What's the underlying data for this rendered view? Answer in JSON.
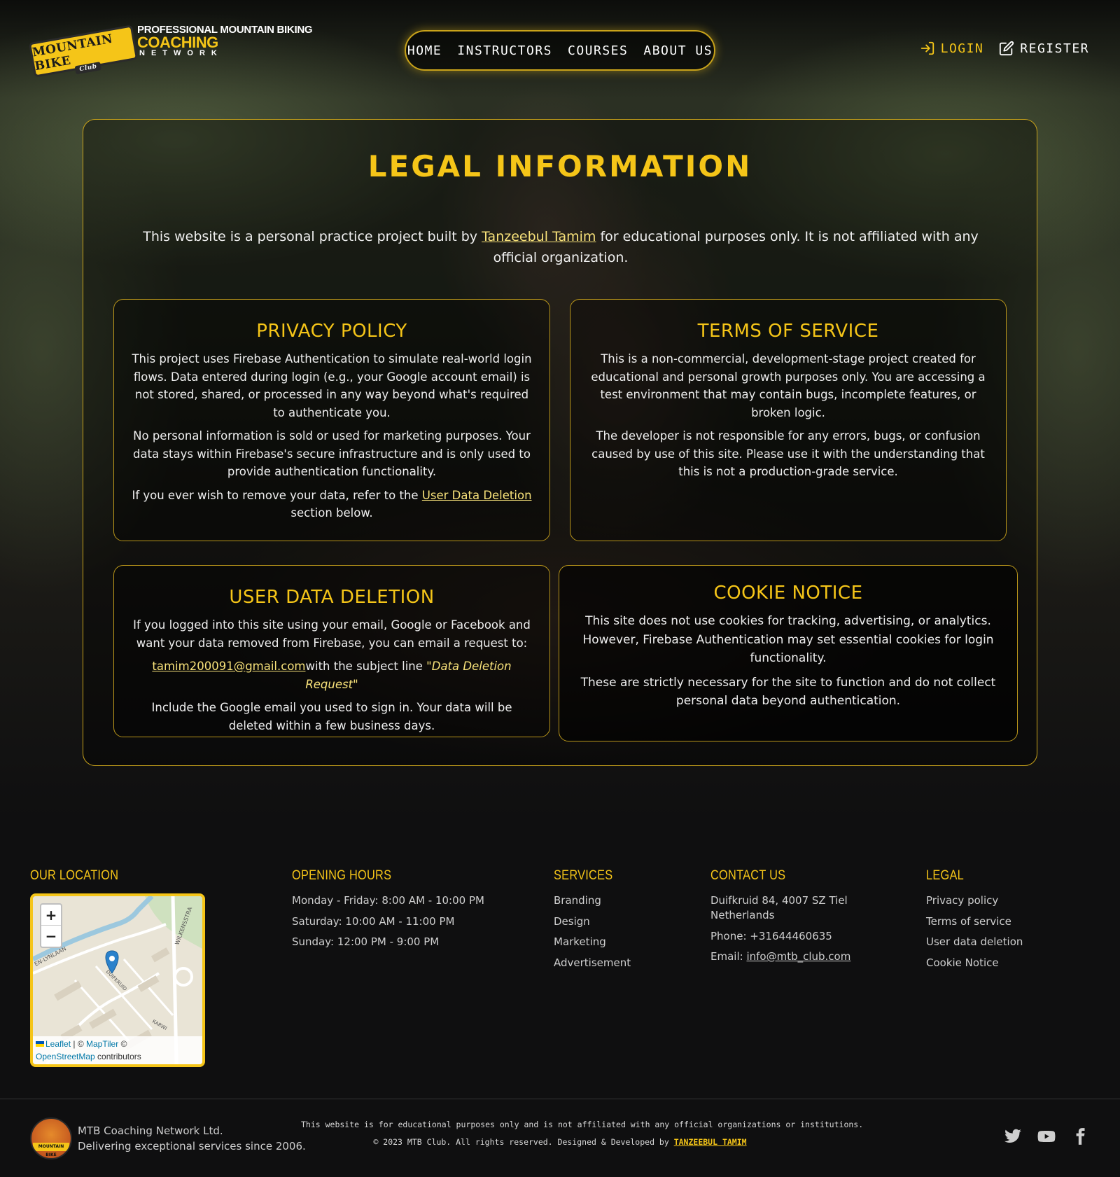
{
  "header": {
    "logo": {
      "badge_text": "MOUNTAIN BIKE",
      "badge_sub": "Club",
      "line1": "PROFESSIONAL MOUNTAIN BIKING",
      "line2": "COACHING",
      "line3": "NETWORK"
    },
    "nav": [
      "HOME",
      "INSTRUCTORS",
      "COURSES",
      "ABOUT US"
    ],
    "login_label": "LOGIN",
    "register_label": "REGISTER"
  },
  "legal": {
    "title": "LEGAL INFORMATION",
    "intro_before": "This website is a personal practice project built by ",
    "intro_link": "Tanzeebul Tamim",
    "intro_after": " for educational purposes only. It is not affiliated with any official organization.",
    "privacy": {
      "title": "PRIVACY POLICY",
      "p1": "This project uses Firebase Authentication to simulate real-world login flows. Data entered during login (e.g., your Google account email) is not stored, shared, or processed in any way beyond what's required to authenticate you.",
      "p2": "No personal information is sold or used for marketing purposes. Your data stays within Firebase's secure infrastructure and is only used to provide authentication functionality.",
      "p3_before": "If you ever wish to remove your data, refer to the ",
      "p3_link": "User Data Deletion",
      "p3_after": " section below."
    },
    "terms": {
      "title": "TERMS OF SERVICE",
      "p1": "This is a non-commercial, development-stage project created for educational and personal growth purposes only. You are accessing a test environment that may contain bugs, incomplete features, or broken logic.",
      "p2": "The developer is not responsible for any errors, bugs, or confusion caused by use of this site. Please use it with the understanding that this is not a production-grade service."
    },
    "deletion": {
      "title": "USER DATA DELETION",
      "p1": "If you logged into this site using your email, Google or Facebook and want your data removed from Firebase, you can email a request to:",
      "email": "tamim200091@gmail.com",
      "subject_before": "with the subject line ",
      "subject": "\"Data Deletion Request\"",
      "p3": "Include the Google email you used to sign in. Your data will be deleted within a few business days."
    },
    "cookie": {
      "title": "COOKIE NOTICE",
      "p1": "This site does not use cookies for tracking, advertising, or analytics. However, Firebase Authentication may set essential cookies for login functionality.",
      "p2": "These are strictly necessary for the site to function and do not collect personal data beyond authentication."
    }
  },
  "footer": {
    "location": {
      "title": "OUR LOCATION",
      "zoom_in": "+",
      "zoom_out": "−",
      "attrib_leaflet": "Leaflet",
      "attrib_sep": " | © ",
      "attrib_maptiler": "MapTiler",
      "attrib_copy": " ©",
      "attrib_osm": "OpenStreetMap",
      "attrib_contrib": " contributors",
      "street1": "WILKENSSTRA",
      "street2": "EN-LYNLAAN",
      "street3": "DUIFKRUID",
      "street4": "KARWI"
    },
    "hours": {
      "title": "OPENING HOURS",
      "lines": [
        "Monday - Friday: 8:00 AM - 10:00 PM",
        "Saturday: 10:00 AM - 11:00 PM",
        "Sunday: 12:00 PM - 9:00 PM"
      ]
    },
    "services": {
      "title": "SERVICES",
      "items": [
        "Branding",
        "Design",
        "Marketing",
        "Advertisement"
      ]
    },
    "contact": {
      "title": "CONTACT US",
      "address1": "Duifkruid 84, 4007 SZ Tiel",
      "address2": "Netherlands",
      "phone": "Phone: +31644460635",
      "email_label": "Email: ",
      "email": "info@mtb_club.com"
    },
    "legal": {
      "title": "LEGAL",
      "items": [
        "Privacy policy",
        "Terms of service",
        "User data deletion",
        "Cookie Notice"
      ]
    },
    "bottom": {
      "logo_text": "MOUNTAIN BIKE",
      "company_name": "MTB Coaching Network Ltd.",
      "company_tagline": "Delivering exceptional services since 2006.",
      "disclaimer": "This website is for educational purposes only and is not affiliated with any official organizations or institutions.",
      "copyright": "© 2023 MTB Club. All rights reserved. Designed & Developed by ",
      "developer": "TANZEEBUL TAMIM"
    }
  },
  "colors": {
    "accent": "#f5c518",
    "background": "#0f0f10",
    "text": "#e8e8e8"
  }
}
